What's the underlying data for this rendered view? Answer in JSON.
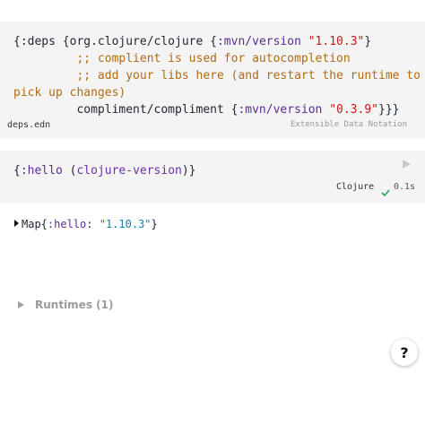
{
  "deps_cell": {
    "lines": {
      "l1_a": "{:deps {org.clojure/clojure {",
      "l1_kw": ":mvn/version",
      "l1_sp": " ",
      "l1_str": "\"1.10.3\"",
      "l1_end": "}",
      "l2": "         ;; complient is used for autocompletion",
      "l3": "         ;; add your libs here (and restart the runtime to",
      "l4": "pick up changes)",
      "l5_a": "         compliment/compliment {",
      "l5_kw": ":mvn/version",
      "l5_sp": " ",
      "l5_str": "\"0.3.9\"",
      "l5_end": "}}}"
    },
    "filename": "deps.edn",
    "format_label": "Extensible Data Notation"
  },
  "code_cell": {
    "code_open": "{",
    "code_kw": ":hello",
    "code_mid": " (",
    "code_fn": "clojure-version",
    "code_close": ")}",
    "runtime": "Clojure",
    "duration": "0.1s",
    "status_color": "#2e9e4f"
  },
  "result": {
    "prefix": "Map{",
    "key": ":hello",
    "sep": ": ",
    "value": "\"1.10.3\"",
    "suffix": "}"
  },
  "runtimes": {
    "label": "Runtimes (1)"
  },
  "help": {
    "label": "?"
  },
  "icons": [
    "play-icon",
    "check-icon",
    "expand-triangle-icon",
    "collapse-arrow-icon",
    "help-icon"
  ]
}
